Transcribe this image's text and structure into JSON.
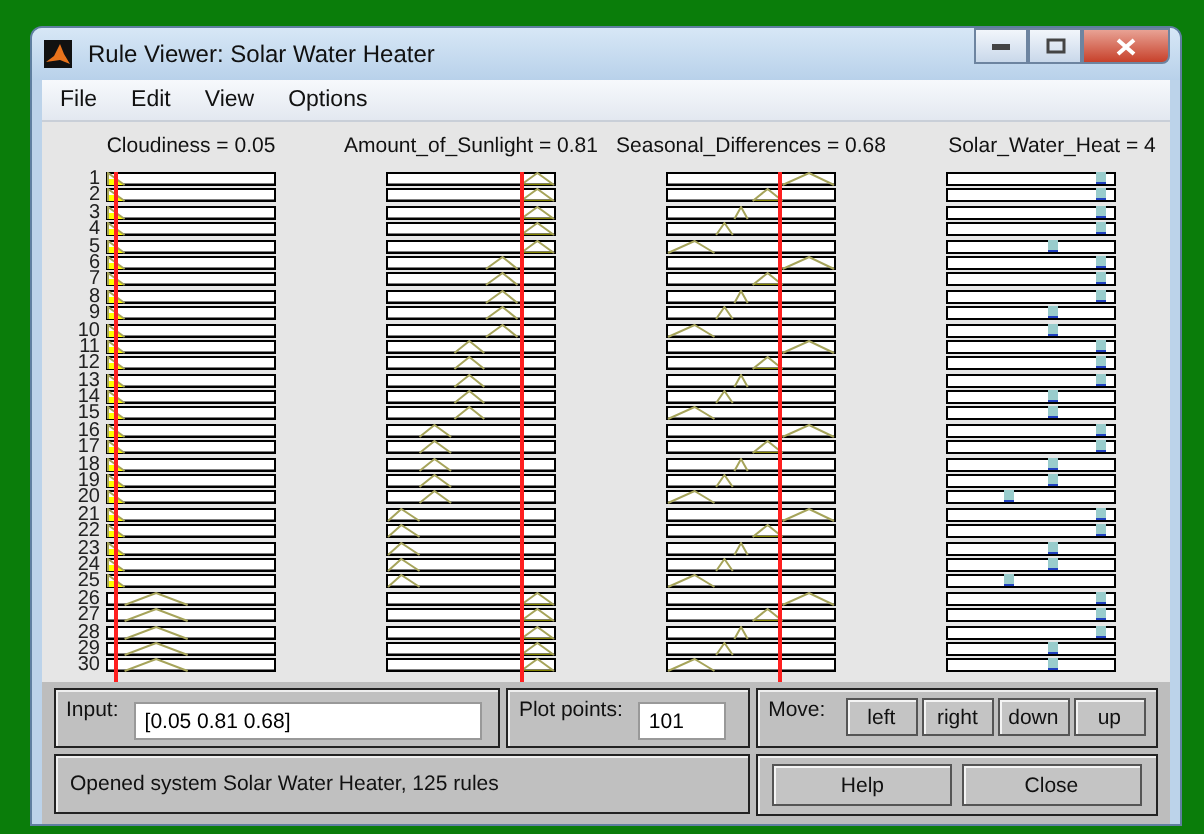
{
  "window": {
    "title": "Rule Viewer: Solar Water Heater"
  },
  "menu": [
    "File",
    "Edit",
    "View",
    "Options"
  ],
  "inputs": [
    {
      "label": "Cloudiness = 0.05"
    },
    {
      "label": "Amount_of_Sunlight = 0.81"
    },
    {
      "label": "Seasonal_Differences = 0.68"
    }
  ],
  "output": {
    "label": "Solar_Water_Heat = 4"
  },
  "rules": [
    {
      "number": "1",
      "level": 0.92
    },
    {
      "number": "2",
      "level": 0.92
    },
    {
      "number": "3",
      "level": 0.92
    },
    {
      "number": "4",
      "level": 0.92
    },
    {
      "number": "5",
      "level": 0.63
    },
    {
      "number": "6",
      "level": 0.92
    },
    {
      "number": "7",
      "level": 0.92
    },
    {
      "number": "8",
      "level": 0.92
    },
    {
      "number": "9",
      "level": 0.63
    },
    {
      "number": "10",
      "level": 0.63
    },
    {
      "number": "11",
      "level": 0.92
    },
    {
      "number": "12",
      "level": 0.92
    },
    {
      "number": "13",
      "level": 0.92
    },
    {
      "number": "14",
      "level": 0.63
    },
    {
      "number": "15",
      "level": 0.63
    },
    {
      "number": "16",
      "level": 0.92
    },
    {
      "number": "17",
      "level": 0.92
    },
    {
      "number": "18",
      "level": 0.63
    },
    {
      "number": "19",
      "level": 0.63
    },
    {
      "number": "20",
      "level": 0.35
    },
    {
      "number": "21",
      "level": 0.92
    },
    {
      "number": "22",
      "level": 0.92
    },
    {
      "number": "23",
      "level": 0.63
    },
    {
      "number": "24",
      "level": 0.63
    },
    {
      "number": "25",
      "level": 0.35
    },
    {
      "number": "26",
      "level": 0.92
    },
    {
      "number": "27",
      "level": 0.92
    },
    {
      "number": "28",
      "level": 0.92
    },
    {
      "number": "29",
      "level": 0.63
    },
    {
      "number": "30",
      "level": 0.63
    }
  ],
  "input_field": {
    "label": "Input:",
    "value": "[0.05 0.81 0.68]"
  },
  "plot_points": {
    "label": "Plot points:",
    "value": "101"
  },
  "move": {
    "label": "Move:",
    "buttons": [
      "left",
      "right",
      "down",
      "up"
    ]
  },
  "status": "Opened system Solar Water Heater, 125 rules",
  "buttons": [
    "Help",
    "Close"
  ]
}
